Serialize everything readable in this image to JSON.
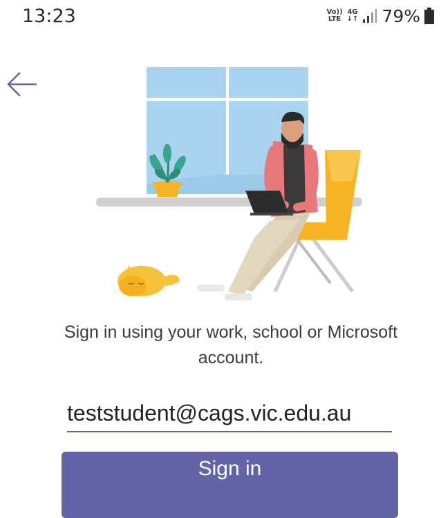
{
  "status_bar": {
    "time": "13:23",
    "volte_top": "Vo))",
    "volte_bottom": "LTE",
    "network_top": "4G",
    "network_bottom": "↓↑",
    "battery_percent": "79%"
  },
  "signin": {
    "prompt": "Sign in using your work, school or Microsoft account.",
    "email_value": "teststudent@cags.vic.edu.au",
    "button_label": "Sign in"
  },
  "colors": {
    "accent": "#6264a7",
    "window_glass": "#a9d4f0",
    "chair": "#f6b324",
    "shirt": "#e8787a",
    "cat": "#f6c23a"
  },
  "icons": {
    "back": "arrow-left-icon",
    "signal": "signal-bars-icon",
    "battery": "battery-icon"
  }
}
